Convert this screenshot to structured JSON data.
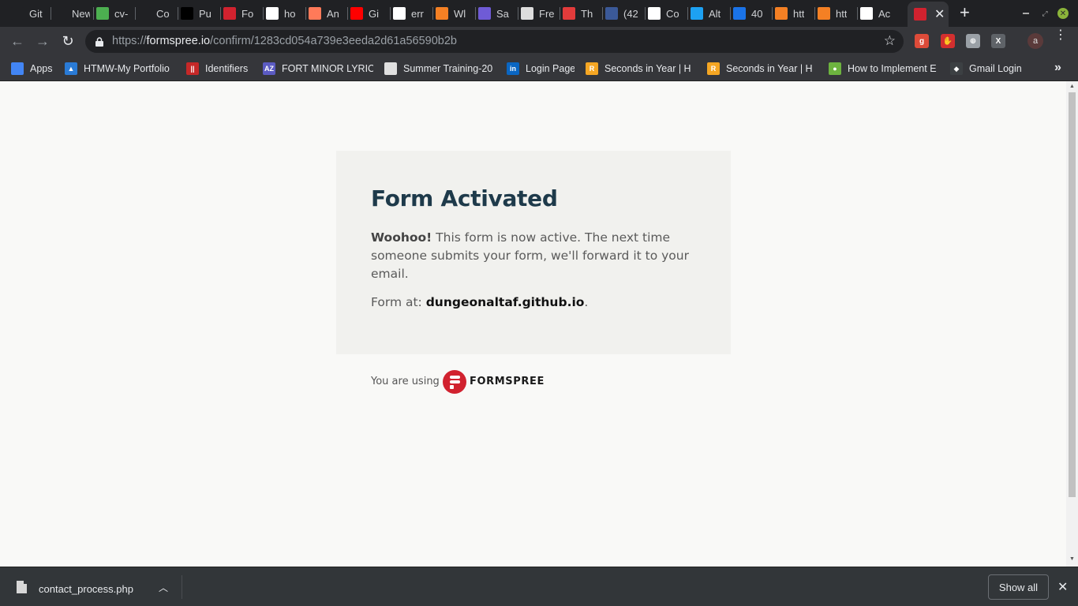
{
  "tabs": [
    {
      "title": "Git",
      "icon": "github-icon",
      "color": "#202124"
    },
    {
      "title": "New Ta",
      "icon": "blank-icon",
      "color": "#202124"
    },
    {
      "title": "cv-",
      "icon": "cv-leaf-icon",
      "color": "#4caf50"
    },
    {
      "title": "Co",
      "icon": "github-icon",
      "color": "#202124"
    },
    {
      "title": "Pu",
      "icon": "medium-icon",
      "color": "#000000"
    },
    {
      "title": "Fo",
      "icon": "formspree-icon",
      "color": "#d1222f"
    },
    {
      "title": "ho",
      "icon": "google-icon",
      "color": "#ffffff"
    },
    {
      "title": "An",
      "icon": "hubspot-icon",
      "color": "#ff7a59"
    },
    {
      "title": "Gi",
      "icon": "youtube-icon",
      "color": "#ff0000"
    },
    {
      "title": "err",
      "icon": "google-icon",
      "color": "#ffffff"
    },
    {
      "title": "Wl",
      "icon": "stackoverflow-icon",
      "color": "#f48024"
    },
    {
      "title": "Sa",
      "icon": "s-icon",
      "color": "#6f5bd6"
    },
    {
      "title": "Fre",
      "icon": "grid-icon",
      "color": "#dddddd"
    },
    {
      "title": "Th",
      "icon": "red-circle-icon",
      "color": "#e23b3b"
    },
    {
      "title": "(42",
      "icon": "facebook-icon",
      "color": "#3b5998"
    },
    {
      "title": "Co",
      "icon": "gmail-icon",
      "color": "#ffffff"
    },
    {
      "title": "Alt",
      "icon": "twitter-icon",
      "color": "#1da1f2"
    },
    {
      "title": "40",
      "icon": "o-icon",
      "color": "#1a73e8"
    },
    {
      "title": "htt",
      "icon": "stackoverflow-icon",
      "color": "#f48024"
    },
    {
      "title": "htt",
      "icon": "stackoverflow-icon",
      "color": "#f48024"
    },
    {
      "title": "Ac",
      "icon": "gmail-icon",
      "color": "#ffffff"
    }
  ],
  "active_tab": {
    "icon": "formspree-icon",
    "close_glyph": "✕"
  },
  "new_tab_glyph": "+",
  "toolbar": {
    "back_glyph": "←",
    "forward_glyph": "→",
    "reload_glyph": "↻",
    "url_scheme": "https://",
    "url_host": "formspree.io",
    "url_path": "/confirm/1283cd054a739e3eeda2d61a56590b2b",
    "star_glyph": "☆",
    "profile_initial": "a",
    "menu_glyph": "⋮"
  },
  "extensions": [
    {
      "name": "google-plus-ext-icon",
      "color": "#dd4b39",
      "text": "g"
    },
    {
      "name": "adblock-ext-icon",
      "color": "#d32f2f",
      "text": "✋"
    },
    {
      "name": "globe-ext-icon",
      "color": "#9aa0a6",
      "text": "⊕"
    },
    {
      "name": "x-ext-icon",
      "color": "#5f6368",
      "text": "X"
    }
  ],
  "bookmarks": [
    {
      "label": "Apps",
      "icon": "apps-grid-icon",
      "color": "#4285f4",
      "glyph": ""
    },
    {
      "label": "HTMW-My Portfolio",
      "icon": "portfolio-icon",
      "color": "#2a7bd6",
      "glyph": "▲"
    },
    {
      "label": "Identifiers",
      "icon": "identifiers-icon",
      "color": "#c62828",
      "glyph": "||"
    },
    {
      "label": "FORT MINOR LYRICS",
      "icon": "az-lyrics-icon",
      "color": "#5b5bc2",
      "glyph": "AZ"
    },
    {
      "label": "Summer Training-20",
      "icon": "doc-icon",
      "color": "#e0e0e0",
      "glyph": ""
    },
    {
      "label": "Login Page",
      "icon": "linkedin-icon",
      "color": "#0a66c2",
      "glyph": "in"
    },
    {
      "label": "Seconds in Year | H",
      "icon": "r-icon",
      "color": "#f5a623",
      "glyph": "R"
    },
    {
      "label": "Seconds in Year | H",
      "icon": "r-icon",
      "color": "#f5a623",
      "glyph": "R"
    },
    {
      "label": "How to Implement E",
      "icon": "leaf-icon",
      "color": "#6db33f",
      "glyph": "●"
    },
    {
      "label": "Gmail Login",
      "icon": "gmail-login-icon",
      "color": "#3c4043",
      "glyph": "◆"
    }
  ],
  "bookmarks_more_glyph": "»",
  "content": {
    "title": "Form Activated",
    "lead_bold": "Woohoo!",
    "lead_text": " This form is now active. The next time someone submits your form, we'll forward it to your email.",
    "form_at_label": "Form at: ",
    "form_domain": "dungeonaltaf.github.io",
    "form_at_suffix": ".",
    "using_label": "You are using",
    "brand_name": "FORMSPREE",
    "brand_color": "#d1222f"
  },
  "download": {
    "filename": "contact_process.php",
    "chevron_glyph": "︿",
    "show_all_label": "Show all",
    "close_glyph": "✕"
  }
}
